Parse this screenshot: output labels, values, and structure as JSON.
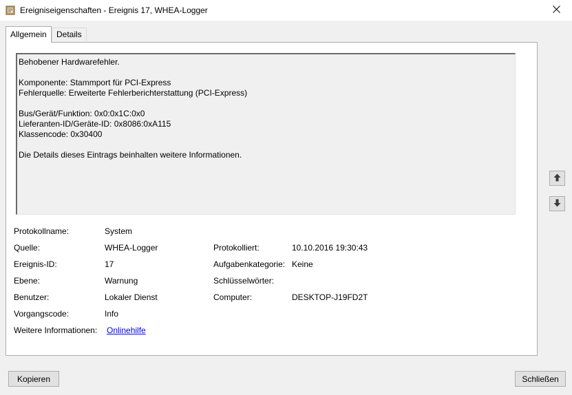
{
  "window": {
    "title": "Ereigniseigenschaften - Ereignis 17, WHEA-Logger",
    "app_icon": "event-viewer-icon",
    "close_icon": "close-icon"
  },
  "tabs": [
    {
      "label": "Allgemein",
      "active": true
    },
    {
      "label": "Details",
      "active": false
    }
  ],
  "description_lines": [
    "Behobener Hardwarefehler.",
    "Komponente: Stammport für PCI-Express",
    "Fehlerquelle: Erweiterte Fehlerberichterstattung (PCI-Express)",
    "Bus/Gerät/Funktion: 0x0:0x1C:0x0",
    "Lieferanten-ID/Geräte-ID: 0x8086:0xA115",
    "Klassencode: 0x30400",
    "Die Details dieses Eintrags beinhalten weitere Informationen."
  ],
  "properties": {
    "protokollname": {
      "label": "Protokollname:",
      "value": "System"
    },
    "quelle": {
      "label": "Quelle:",
      "value": "WHEA-Logger"
    },
    "protokolliert": {
      "label": "Protokolliert:",
      "value": "10.10.2016 19:30:43"
    },
    "ereignis_id": {
      "label": "Ereignis-ID:",
      "value": "17"
    },
    "aufgabenkategorie": {
      "label": "Aufgabenkategorie:",
      "value": "Keine"
    },
    "ebene": {
      "label": "Ebene:",
      "value": "Warnung"
    },
    "schluesselwoerter": {
      "label": "Schlüsselwörter:",
      "value": ""
    },
    "benutzer": {
      "label": "Benutzer:",
      "value": "Lokaler Dienst"
    },
    "computer": {
      "label": "Computer:",
      "value": "DESKTOP-J19FD2T"
    },
    "vorgangscode": {
      "label": "Vorgangscode:",
      "value": "Info"
    },
    "weitere_informationen": {
      "label": "Weitere Informationen:",
      "value": "Onlinehilfe"
    }
  },
  "navigation": {
    "up_icon": "arrow-up-icon",
    "down_icon": "arrow-down-icon"
  },
  "buttons": {
    "copy": "Kopieren",
    "close": "Schließen"
  },
  "colors": {
    "link": "#0000ee",
    "background": "#f0f0f0"
  }
}
